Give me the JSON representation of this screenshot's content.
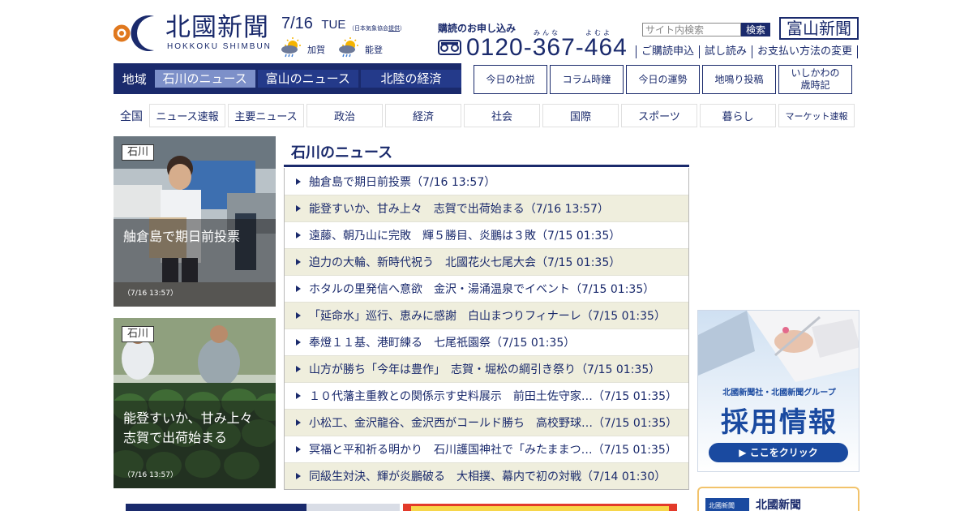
{
  "header": {
    "logo_jp": "北國新聞",
    "logo_en": "HOKKOKU SHIMBUN",
    "date": "7/16",
    "weekday": "TUE",
    "weather_note_prefix": "（日本気象協会",
    "weather_note_link": "提供",
    "weather_note_suffix": "）",
    "weather": [
      {
        "area": "加賀",
        "icon": "sun-cloud-rain-icon"
      },
      {
        "area": "能登",
        "icon": "sun-cloud-rain-icon"
      }
    ],
    "subscribe_label": "購読のお申し込み",
    "phone_ruby_1": "みんな",
    "phone_ruby_2": "よむよ",
    "phone": "0120-367-464",
    "search_placeholder": "サイト内検索",
    "search_button": "検索",
    "toyama_link": "富山新聞",
    "sub_links": [
      "ご購読申込",
      "試し読み",
      "お支払い方法の変更"
    ]
  },
  "region_nav": {
    "label": "地域",
    "tabs": [
      {
        "label": "石川のニュース",
        "active": true
      },
      {
        "label": "富山のニュース",
        "active": false
      },
      {
        "label": "北陸の経済",
        "active": false
      }
    ]
  },
  "column_buttons": [
    "今日の社説",
    "コラム時鐘",
    "今日の運勢",
    "地鳴り投稿",
    "いしかわの\n歳時記"
  ],
  "category_nav": {
    "all": "全国",
    "items": [
      "ニュース速報",
      "主要ニュース",
      "政治",
      "経済",
      "社会",
      "国際",
      "スポーツ",
      "暮らし",
      "マーケット速報"
    ]
  },
  "photos": [
    {
      "tag": "石川",
      "caption": "舳倉島で期日前投票",
      "time": "（7/16 13:57）"
    },
    {
      "tag": "石川",
      "caption": "能登すいか、甘み上々\n志賀で出荷始まる",
      "time": "（7/16 13:57）"
    }
  ],
  "news": {
    "heading": "石川のニュース",
    "items": [
      "舳倉島で期日前投票（7/16 13:57）",
      "能登すいか、甘み上々　志賀で出荷始まる（7/16 13:57）",
      "遠藤、朝乃山に完敗　輝５勝目、炎鵬は３敗（7/15 01:35）",
      "迫力の大輪、新時代祝う　北國花火七尾大会（7/15 01:35）",
      "ホタルの里発信へ意欲　金沢・湯涌温泉でイベント（7/15 01:35）",
      "「延命水」巡行、恵みに感謝　白山まつりフィナーレ（7/15 01:35）",
      "奉燈１１基、港町練る　七尾祇園祭（7/15 01:35）",
      "山方が勝ち「今年は豊作」　志賀・堀松の綱引き祭り（7/15 01:35）",
      "１０代藩主重教との関係示す史料展示　前田土佐守家…（7/15 01:35）",
      "小松工、金沢龍谷、金沢西がコールド勝ち　高校野球…（7/15 01:35）",
      "冥福と平和祈る明かり　石川護国神社で「みたままつ…（7/15 01:35）",
      "同級生対決、輝が炎鵬破る　大相撲、幕内で初の対戦（7/14 01:30）"
    ]
  },
  "ads": {
    "recruit_small": "北國新聞社・北國新聞グループ",
    "recruit_big": "採用情報",
    "recruit_button": "▶ ここをクリック",
    "app_icon_text": "北國新聞",
    "app_title": "北國新聞"
  },
  "colors": {
    "brand_navy": "#1a2a6c",
    "active_tab": "#7d90c9",
    "stripe": "#efeedd",
    "recruit_blue": "#1a4aa0"
  }
}
